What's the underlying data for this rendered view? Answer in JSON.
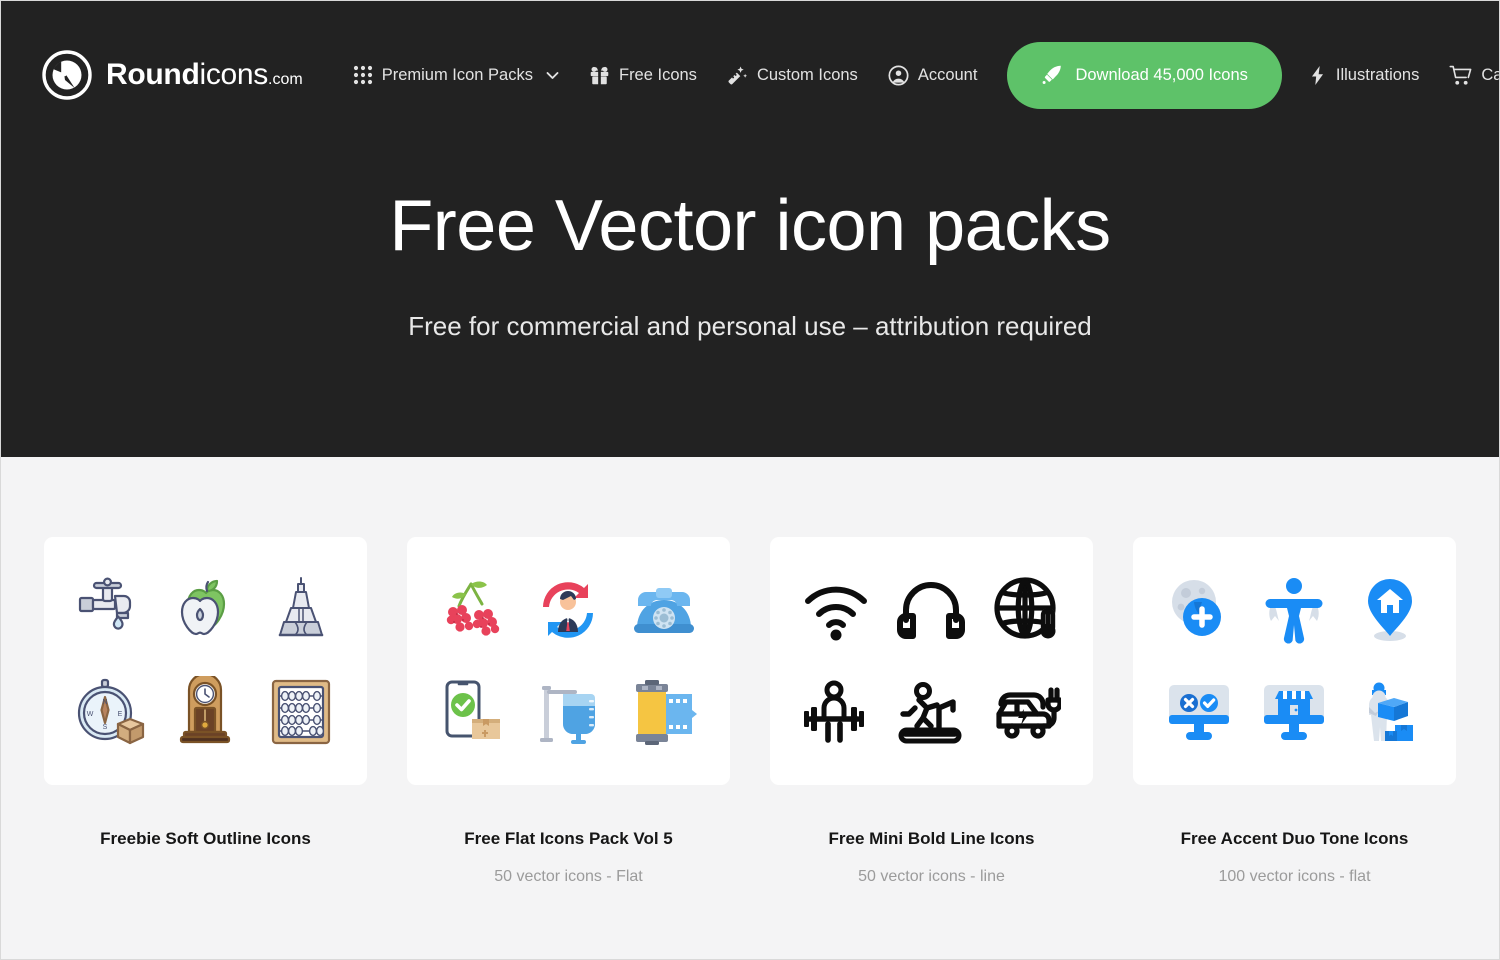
{
  "brand": {
    "logo_icon": "roundicons-compass-logo",
    "name_bold": "Round",
    "name_light": "icons",
    "suffix": ".com"
  },
  "colors": {
    "header_bg": "#222222",
    "page_bg": "#f4f4f5",
    "cta_green": "#5ec269",
    "card_bg": "#ffffff",
    "title_text": "#161616",
    "sub_text": "#9b9b9b",
    "nav_text": "#e2e2e2"
  },
  "nav": {
    "left_items": [
      {
        "label": "Premium Icon Packs",
        "icon": "grid-dots-icon",
        "has_caret": true
      },
      {
        "label": "Free Icons",
        "icon": "gift-icon",
        "has_caret": false
      },
      {
        "label": "Custom Icons",
        "icon": "magic-wand-icon",
        "has_caret": false
      },
      {
        "label": "Account",
        "icon": "user-circle-icon",
        "has_caret": false
      }
    ],
    "cta": {
      "label": "Download 45,000 Icons",
      "icon": "rocket-icon"
    },
    "right_items": [
      {
        "label": "Illustrations",
        "icon": "lightning-bolt-icon"
      },
      {
        "label": "Cart",
        "icon": "shopping-cart-icon"
      }
    ]
  },
  "hero": {
    "title": "Free Vector icon packs",
    "subtitle": "Free for commercial and personal use – attribution required"
  },
  "cards": [
    {
      "title": "Freebie Soft Outline Icons",
      "subtitle": "",
      "style": "soft-outline",
      "icons": [
        "faucet-water-drop-icon",
        "green-apple-icon",
        "eiffel-tower-icon",
        "compass-package-icon",
        "mantel-clock-icon",
        "abacus-icon"
      ]
    },
    {
      "title": "Free Flat Icons Pack Vol 5",
      "subtitle": "50 vector icons - Flat",
      "style": "flat",
      "icons": [
        "raspberries-icon",
        "businessman-rotation-icon",
        "rotary-telephone-icon",
        "phone-delivery-confirmed-icon",
        "iv-drip-bag-icon",
        "film-roll-icon"
      ]
    },
    {
      "title": "Free Mini Bold Line Icons",
      "subtitle": "50 vector icons - line",
      "style": "bold-line",
      "icons": [
        "wifi-icon",
        "headphones-icon",
        "globe-thermometer-icon",
        "weightlifter-icon",
        "treadmill-runner-icon",
        "electric-car-plug-icon"
      ]
    },
    {
      "title": "Free Accent Duo Tone Icons",
      "subtitle": "100 vector icons - flat",
      "style": "duo-tone",
      "icons": [
        "globe-add-icon",
        "accessibility-person-icon",
        "home-location-pin-icon",
        "monitor-check-cross-icon",
        "online-shop-monitor-icon",
        "delivery-person-boxes-icon"
      ]
    }
  ]
}
